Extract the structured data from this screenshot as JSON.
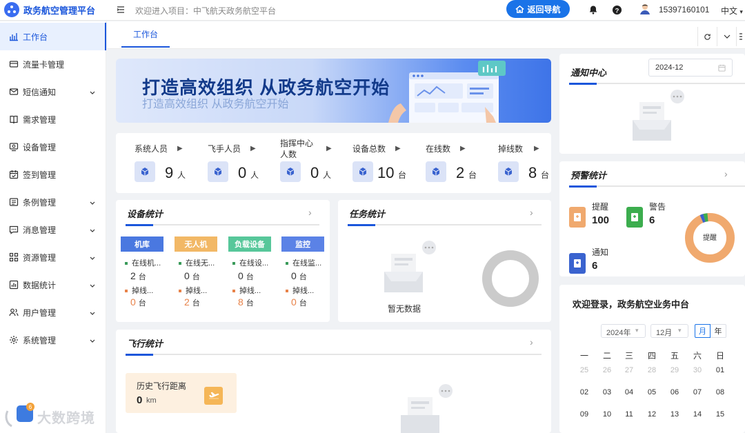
{
  "header": {
    "app_title": "政务航空管理平台",
    "welcome": "欢迎进入项目：中飞航天政务航空平台",
    "back_nav": "返回导航",
    "phone": "15397160101",
    "language": "中文"
  },
  "sidebar": {
    "items": [
      {
        "label": "工作台"
      },
      {
        "label": "流量卡管理"
      },
      {
        "label": "短信通知"
      },
      {
        "label": "需求管理"
      },
      {
        "label": "设备管理"
      },
      {
        "label": "签到管理"
      },
      {
        "label": "条例管理"
      },
      {
        "label": "消息管理"
      },
      {
        "label": "资源管理"
      },
      {
        "label": "数据统计"
      },
      {
        "label": "用户管理"
      },
      {
        "label": "系统管理"
      }
    ]
  },
  "tabs": {
    "active": "工作台"
  },
  "banner": {
    "title": "打造高效组织 从政务航空开始",
    "subtitle": "打造高效组织 从政务航空开始"
  },
  "stats": [
    {
      "label": "系统人员",
      "value": "9",
      "unit": "人"
    },
    {
      "label": "飞手人员",
      "value": "0",
      "unit": "人"
    },
    {
      "label": "指挥中心人数",
      "value": "0",
      "unit": "人"
    },
    {
      "label": "设备总数",
      "value": "10",
      "unit": "台"
    },
    {
      "label": "在线数",
      "value": "2",
      "unit": "台"
    },
    {
      "label": "掉线数",
      "value": "8",
      "unit": "台"
    }
  ],
  "device_stats": {
    "title": "设备统计",
    "columns": [
      {
        "name": "机库",
        "online_label": "在线机...",
        "online": "2",
        "offline_label": "掉线...",
        "offline": "0",
        "unit": "台",
        "color": "#4a78e0"
      },
      {
        "name": "无人机",
        "online_label": "在线无...",
        "online": "0",
        "offline_label": "掉线...",
        "offline": "2",
        "unit": "台",
        "color": "#f2b866"
      },
      {
        "name": "负载设备",
        "online_label": "在线设...",
        "online": "0",
        "offline_label": "掉线...",
        "offline": "8",
        "unit": "台",
        "color": "#57c79a"
      },
      {
        "name": "监控",
        "online_label": "在线监...",
        "online": "0",
        "offline_label": "掉线...",
        "offline": "0",
        "unit": "台",
        "color": "#5b82e6"
      }
    ]
  },
  "task_stats": {
    "title": "任务统计",
    "empty": "暂无数据"
  },
  "flight_stats": {
    "title": "飞行统计",
    "distance_label": "历史飞行距离",
    "distance_value": "0",
    "distance_unit": "km"
  },
  "notice_center": {
    "title": "通知中心",
    "date": "2024-12"
  },
  "warning_stats": {
    "title": "预警统计",
    "remind_label": "提醒",
    "remind_value": "100",
    "warn_label": "警告",
    "warn_value": "6",
    "notify_label": "通知",
    "notify_value": "6",
    "donut_label": "提醒"
  },
  "calendar": {
    "welcome": "欢迎登录，政务航空业务中台",
    "year": "2024年",
    "month": "12月",
    "mode_month": "月",
    "mode_year": "年",
    "weekdays": [
      "一",
      "二",
      "三",
      "四",
      "五",
      "六",
      "日"
    ],
    "rows": [
      [
        "25",
        "26",
        "27",
        "28",
        "29",
        "30",
        "01"
      ],
      [
        "02",
        "03",
        "04",
        "05",
        "06",
        "07",
        "08"
      ],
      [
        "09",
        "10",
        "11",
        "12",
        "13",
        "14",
        "15"
      ]
    ]
  },
  "watermark": "大数跨境"
}
